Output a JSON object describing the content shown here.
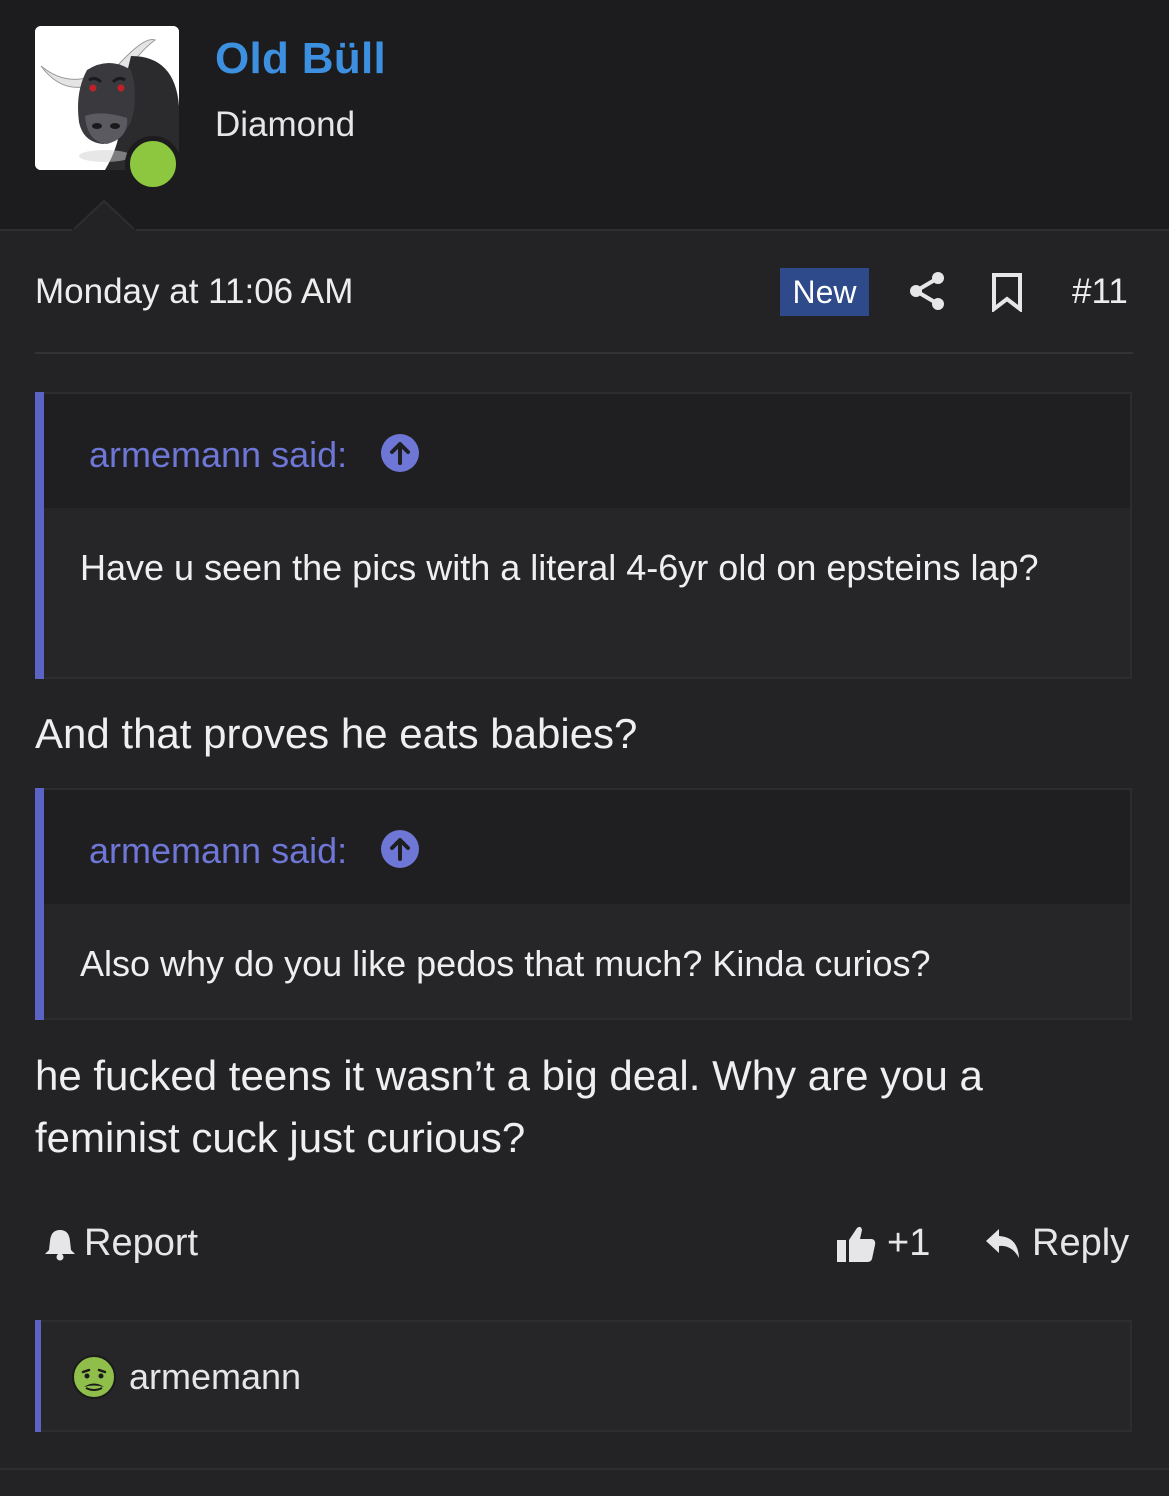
{
  "user": {
    "name": "Old Büll",
    "title": "Diamond",
    "online": true
  },
  "post": {
    "date": "Monday at 11:06 AM",
    "badge": "New",
    "number": "#11"
  },
  "quotes": [
    {
      "author": "armemann said:",
      "text": "Have u seen the pics with a literal 4-6yr old on epsteins lap?"
    },
    {
      "author": "armemann said:",
      "text": "Also why do you like pedos that much? Kinda curios?"
    }
  ],
  "replies": [
    "And that proves he eats babies?",
    "he fucked teens it wasn’t a big deal. Why are you a feminist cuck just curious?"
  ],
  "actions": {
    "report": "Report",
    "like_count": "+1",
    "reply": "Reply"
  },
  "reactions": {
    "user": "armemann",
    "emoji": "nauseated-face-icon"
  },
  "colors": {
    "accent": "#3d8fe0",
    "quote_bar": "#5b64c4",
    "quote_author": "#6e76d6",
    "badge_bg": "#2e4a8a",
    "online": "#8dc63f"
  }
}
